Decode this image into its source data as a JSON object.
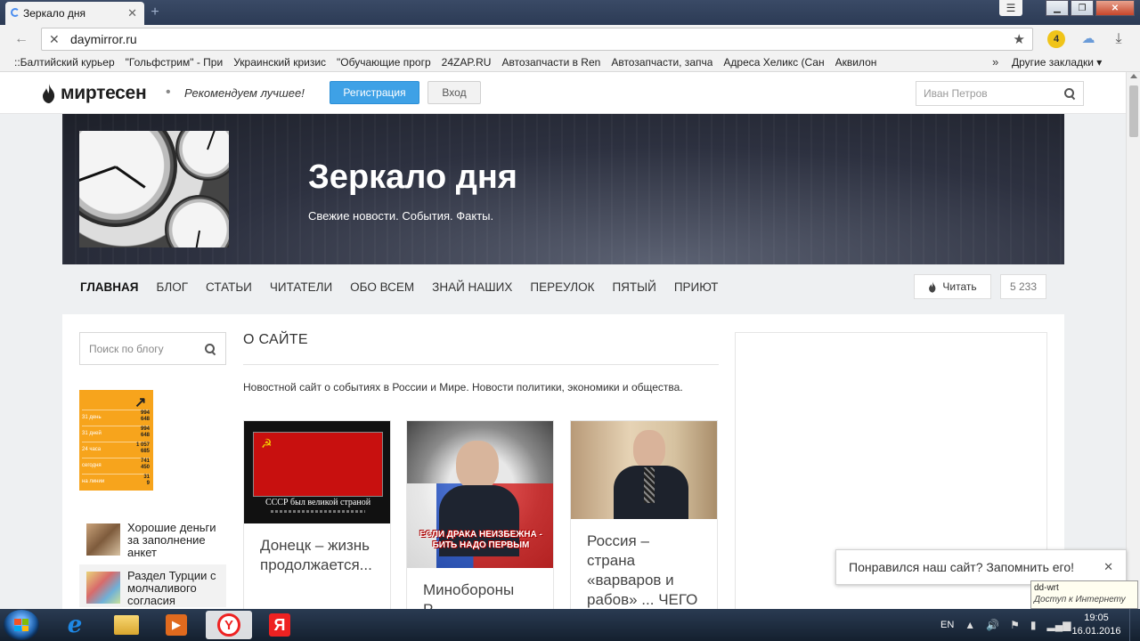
{
  "browser": {
    "tab_title": "Зеркало дня",
    "url": "daymirror.ru",
    "extension_badge": "4",
    "bookmarks": [
      "::Балтийский курьер",
      "\"Гольфстрим\" - При",
      "Украинский кризис",
      "\"Обучающие прогр",
      "24ZAP.RU",
      "Автозапчасти в Ren",
      "Автозапчасти, запча",
      "Адреса Хеликс (Сан",
      "Аквилон"
    ],
    "bookmarks_more": "»",
    "other_bookmarks": "Другие закладки ▾"
  },
  "site": {
    "logo_text": "миртесен",
    "tagline": "Рекомендуем лучшее!",
    "register_label": "Регистрация",
    "login_label": "Вход",
    "search_placeholder": "Иван Петров",
    "banner_title": "Зеркало дня",
    "banner_subtitle": "Свежие новости. События. Факты.",
    "nav": [
      "ГЛАВНАЯ",
      "БЛОГ",
      "СТАТЬИ",
      "ЧИТАТЕЛИ",
      "ОБО ВСЕМ",
      "ЗНАЙ НАШИХ",
      "ПЕРЕУЛОК",
      "ПЯТЫЙ",
      "ПРИЮТ"
    ],
    "read_label": "Читать",
    "read_count": "5 233",
    "blog_search_placeholder": "Поиск по блогу",
    "stats_widget": {
      "rows": [
        {
          "label": "31 день",
          "v1": "994",
          "v2": "648"
        },
        {
          "label": "31 дней",
          "v1": "994",
          "v2": "648"
        },
        {
          "label": "24 часа",
          "v1": "1 057",
          "v2": "685"
        },
        {
          "label": "сегодня",
          "v1": "741",
          "v2": "450"
        },
        {
          "label": "на линии",
          "v1": "31",
          "v2": "9"
        }
      ]
    },
    "promos": [
      "Хорошие деньги за заполнение анкет",
      "Раздел Турции с молчаливого согласия"
    ],
    "section_title": "О САЙТЕ",
    "section_desc": "Новостной сайт о событиях в России и Мире. Новости политики, экономики и общества.",
    "cards": [
      {
        "title": "Донецк – жизнь продолжается...",
        "caption": "СССР был великой страной"
      },
      {
        "title": "Минобороны Р...",
        "caption": "ЕСЛИ ДРАКА НЕИЗБЕЖНА - БИТЬ НАДО ПЕРВЫМ"
      },
      {
        "title": "Россия – страна «варваров и рабов» ... ЧЕГО"
      }
    ],
    "toast_text": "Понравился наш сайт? Запомнить его!",
    "tooltip_title": "dd-wrt",
    "tooltip_sub": "Доступ к Интернету"
  },
  "taskbar": {
    "lang": "EN",
    "time": "19:05",
    "date": "16.01.2016"
  }
}
